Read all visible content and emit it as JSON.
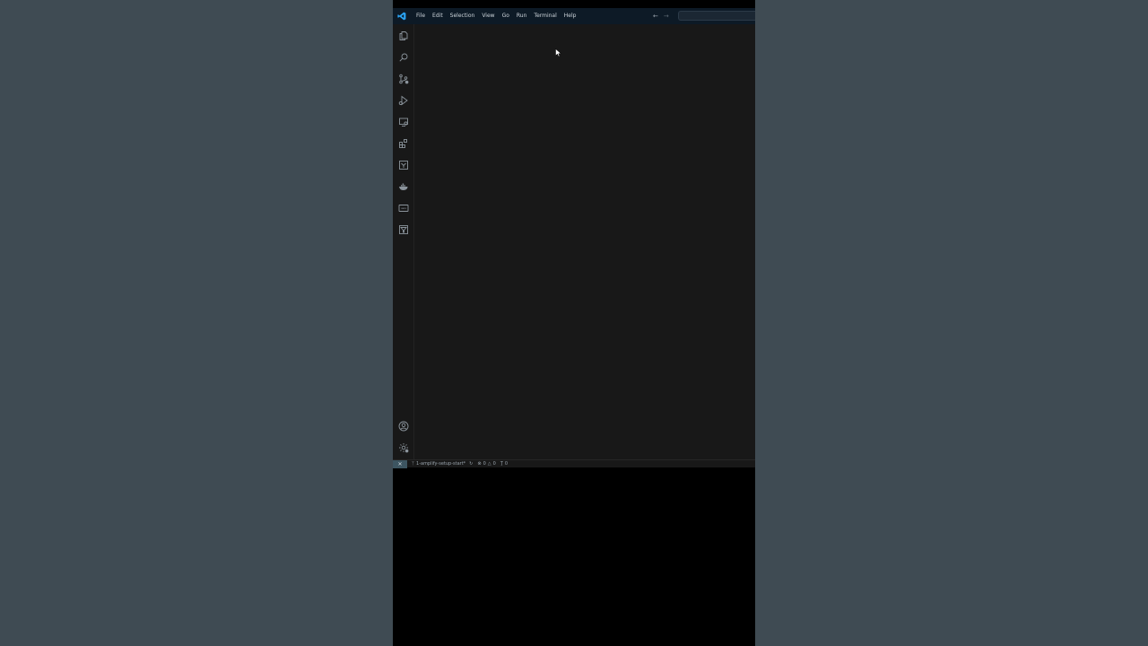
{
  "menu": {
    "items": [
      {
        "label": "File"
      },
      {
        "label": "Edit"
      },
      {
        "label": "Selection"
      },
      {
        "label": "View"
      },
      {
        "label": "Go"
      },
      {
        "label": "Run"
      },
      {
        "label": "Terminal"
      },
      {
        "label": "Help"
      }
    ]
  },
  "navigation": {
    "back_icon": "arrow-left-icon",
    "forward_icon": "arrow-right-icon"
  },
  "activity_bar": {
    "top_icons": [
      "explorer-icon",
      "search-icon",
      "source-control-icon",
      "run-debug-icon",
      "remote-explorer-icon",
      "extensions-icon",
      "testing-icon",
      "docker-icon",
      "aws-icon",
      "filter-icon"
    ],
    "bottom_icons": [
      "accounts-icon",
      "manage-gear-icon"
    ]
  },
  "status_bar": {
    "branch": "1-amplify-setup-start*",
    "errors": "0",
    "warnings": "0",
    "ports": "0"
  },
  "colors": {
    "background": "#3f4b53",
    "editor": "#181818",
    "titlebar": "#0d1a26",
    "accent": "#1e90ff",
    "remote_indicator": "#3d5561"
  }
}
